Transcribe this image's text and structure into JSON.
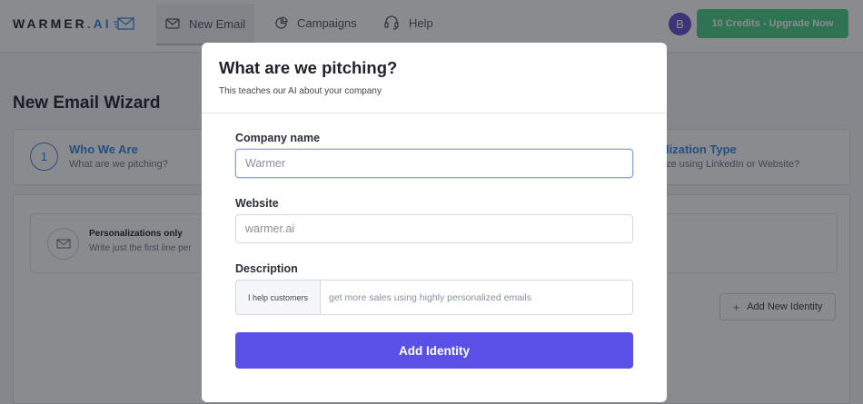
{
  "app": {
    "logo_main": "WARMER",
    "logo_ai": ".AI",
    "nav": [
      {
        "label": "New Email",
        "icon": "envelope-icon"
      },
      {
        "label": "Campaigns",
        "icon": "pie-chart-icon"
      },
      {
        "label": "Help",
        "icon": "headset-icon"
      }
    ],
    "avatar_initial": "B",
    "upgrade_label": "10 Credits - Upgrade Now"
  },
  "wizard": {
    "title": "New Email Wizard",
    "step1": {
      "number": "1",
      "title": "Who We Are",
      "subtitle": "What are we pitching?"
    },
    "step2": {
      "title": "lization Type",
      "subtitle": "ze using LinkedIn or Website?"
    },
    "card": {
      "title": "Personalizations only",
      "subtitle": "Write just the first line per"
    },
    "add_new_label": "Add New Identity"
  },
  "modal": {
    "title": "What are we pitching?",
    "subtitle": "This teaches our AI about your company",
    "company": {
      "label": "Company name",
      "placeholder": "Warmer",
      "value": ""
    },
    "website": {
      "label": "Website",
      "placeholder": "warmer.ai",
      "value": ""
    },
    "description": {
      "label": "Description",
      "prefix": "I help customers",
      "placeholder": "get more sales using highly personalized emails",
      "value": ""
    },
    "submit_label": "Add Identity"
  },
  "colors": {
    "primary": "#5a4fe6",
    "accent_blue": "#3d8fe6",
    "upgrade_green": "#4fd18b",
    "avatar": "#6b59d3"
  }
}
